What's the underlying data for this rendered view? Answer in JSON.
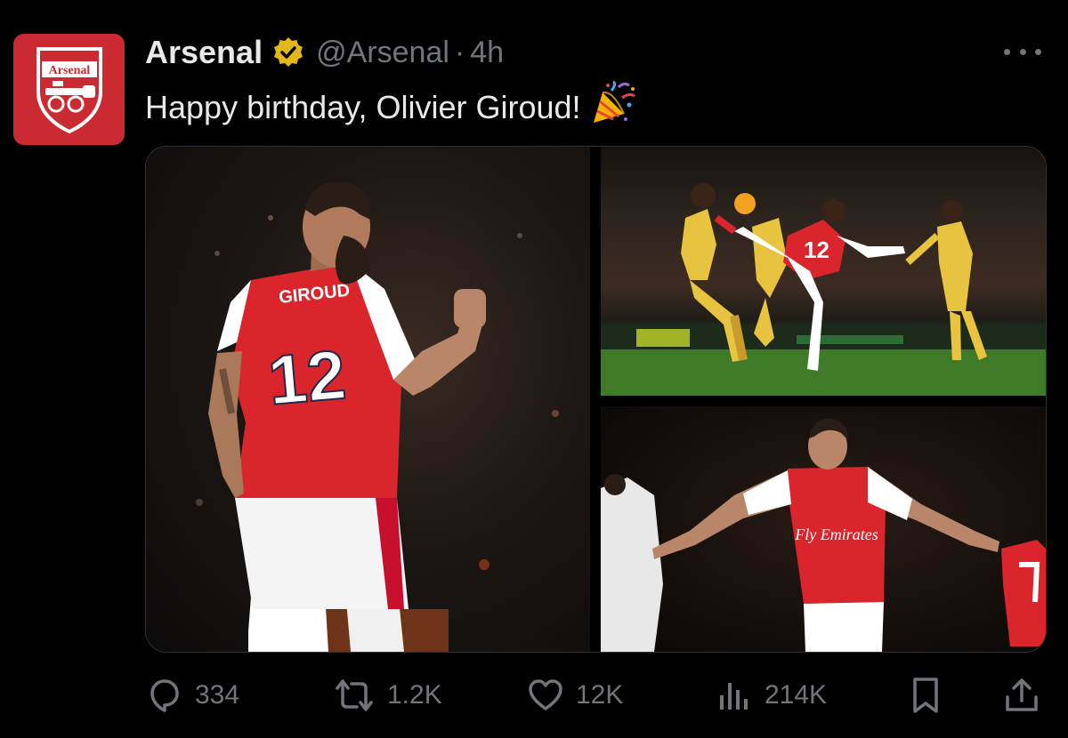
{
  "author": {
    "display_name": "Arsenal",
    "handle": "@Arsenal",
    "separator": "·",
    "time": "4h",
    "avatar_text": "Arsenal",
    "verified": true
  },
  "tweet": {
    "text": "Happy birthday, Olivier Giroud!",
    "emoji": "party-popper"
  },
  "media": {
    "photos": [
      {
        "name": "celebration-fist",
        "jersey_name": "GIROUD",
        "jersey_number": "12"
      },
      {
        "name": "scorpion-kick",
        "jersey_number": "12"
      },
      {
        "name": "arms-outstretched",
        "sponsor": "Fly Emirates"
      }
    ]
  },
  "actions": {
    "reply_count": "334",
    "retweet_count": "1.2K",
    "like_count": "12K",
    "view_count": "214K"
  },
  "colors": {
    "background": "#000000",
    "text": "#e7e9ea",
    "muted": "#71767b",
    "arsenal_red": "#cc2a33",
    "verified_gold": "#e2b719"
  },
  "icons": [
    "more-icon",
    "verified-icon",
    "party-popper-icon",
    "reply-icon",
    "retweet-icon",
    "like-icon",
    "views-icon",
    "bookmark-icon",
    "share-icon"
  ]
}
